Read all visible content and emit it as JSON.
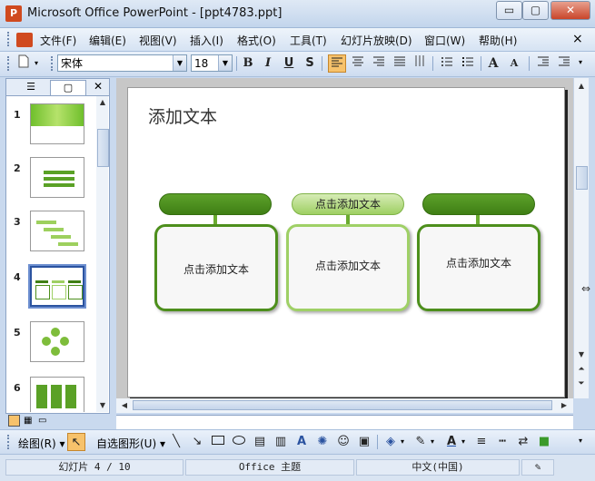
{
  "window": {
    "title": "Microsoft Office PowerPoint - [ppt4783.ppt]",
    "app_icon": "P",
    "minimize": "▭",
    "restore": "▢",
    "close": "✕"
  },
  "menu": {
    "items": [
      "文件(F)",
      "编辑(E)",
      "视图(V)",
      "插入(I)",
      "格式(O)",
      "工具(T)",
      "幻灯片放映(D)",
      "窗口(W)",
      "帮助(H)"
    ],
    "close_doc": "×"
  },
  "format": {
    "font_name": "宋体",
    "font_size": "18",
    "bold": "B",
    "italic": "I",
    "underline": "U",
    "shadow": "S",
    "grow": "A",
    "shrink": "A"
  },
  "pane": {
    "tab_outline": "☰",
    "tab_slides": "▢",
    "close": "✕"
  },
  "slides": [
    {
      "num": "1"
    },
    {
      "num": "2"
    },
    {
      "num": "3"
    },
    {
      "num": "4",
      "selected": true
    },
    {
      "num": "5"
    },
    {
      "num": "6"
    }
  ],
  "slide": {
    "title": "添加文本",
    "top_pill_label": "点击添加文本",
    "box_texts": [
      "点击添加文本",
      "点击添加文本",
      "点击添加文本"
    ],
    "accent_dark": "#3f7f15",
    "accent_light": "#9ecf62"
  },
  "draw": {
    "draw_label": "绘图(R)",
    "autoshape_label": "自选图形(U)"
  },
  "status": {
    "slide_info": "幻灯片 4 / 10",
    "theme": "Office 主题",
    "language": "中文(中国)"
  }
}
